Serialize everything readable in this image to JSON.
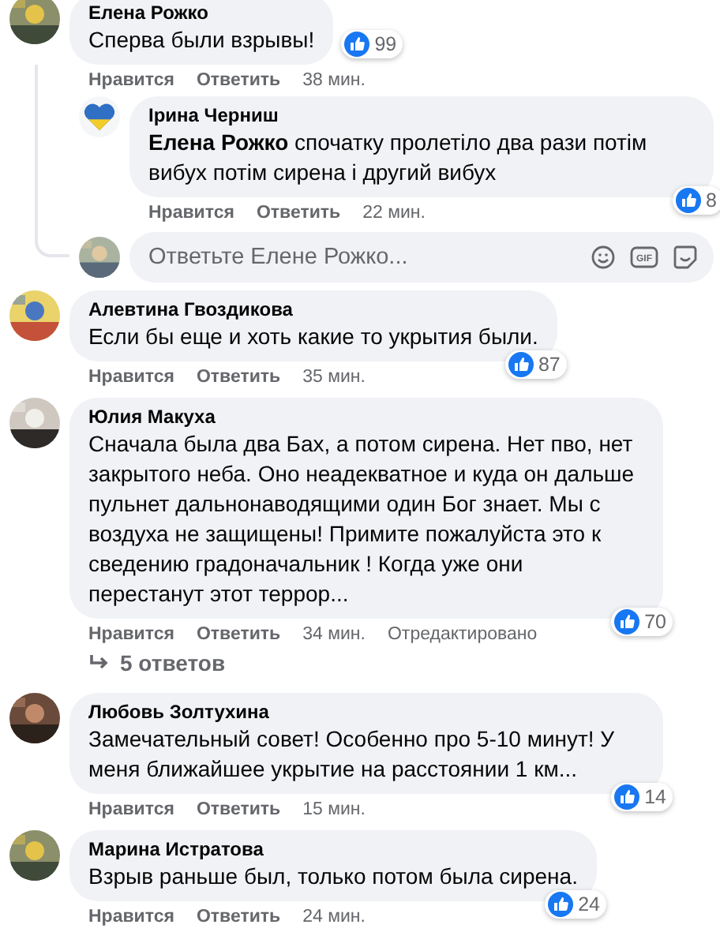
{
  "comments": [
    {
      "author": "Елена Рожко",
      "text": "Сперва были взрывы!",
      "reactions": "99",
      "kind": "short",
      "actions": {
        "like": "Нравится",
        "reply": "Ответить",
        "time": "38 мин."
      },
      "replies": [
        {
          "author": "Ірина Черниш",
          "text": "**Елена Рожко** спочатку пролетіло два рази потім вибух потім сирена і другий вибух",
          "avatar": {
            "kind": "logo"
          },
          "reactions": "8",
          "actions": {
            "like": "Нравится",
            "reply": "Ответить",
            "time": "22 мин."
          }
        }
      ],
      "reply_box": {
        "placeholder": "Ответьте Елене Рожко...",
        "gif_label": "GIF"
      }
    },
    {
      "author": "Алевтина Гвоздикова",
      "text": "Если бы еще и хоть какие то укрытия были.",
      "reactions": "87",
      "actions": {
        "like": "Нравится",
        "reply": "Ответить",
        "time": "35 мин."
      }
    },
    {
      "author": "Юлия Макуха",
      "text": "Сначала была два Бах, а потом сирена. Нет пво, нет закрытого неба. Оно неадекватное и куда он дальше пульнет дальнонаводящими один Бог знает. Мы с воздуха не защищены! Примите пожалуйста это к сведению градоначальник ! Когда уже они перестанут этот террор...",
      "reactions": "70",
      "actions": {
        "like": "Нравится",
        "reply": "Ответить",
        "time": "34 мин.",
        "edited": "Отредактировано"
      },
      "more_replies": "5 ответов"
    },
    {
      "author": "Любовь Золтухина",
      "text": "Замечательный совет! Особенно про 5-10 минут! У меня ближайшее укрытие на расстоянии 1 км...",
      "reactions": "14",
      "actions": {
        "like": "Нравится",
        "reply": "Ответить",
        "time": "15 мин."
      }
    },
    {
      "author": "Марина Истратова",
      "text": "Взрыв раньше был, только потом была сирена.",
      "reactions": "24",
      "actions": {
        "like": "Нравится",
        "reply": "Ответить",
        "time": "24 мин."
      }
    }
  ]
}
